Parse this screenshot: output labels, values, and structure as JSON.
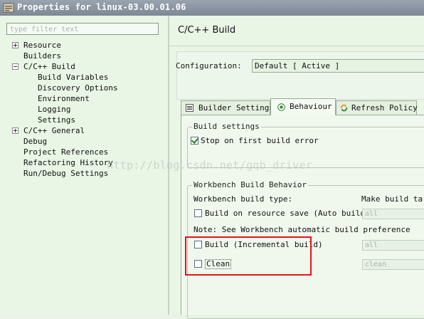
{
  "window": {
    "title": "Properties for linux-03.00.01.06",
    "icon": "properties-icon"
  },
  "sidebar": {
    "filter_placeholder": "type filter text",
    "items": [
      {
        "label": "Resource",
        "toggle": "plus"
      },
      {
        "label": "Builders"
      },
      {
        "label": "C/C++ Build",
        "toggle": "minus"
      },
      {
        "label": "Build Variables"
      },
      {
        "label": "Discovery Options"
      },
      {
        "label": "Environment"
      },
      {
        "label": "Logging"
      },
      {
        "label": "Settings"
      },
      {
        "label": "C/C++ General",
        "toggle": "plus"
      },
      {
        "label": "Debug"
      },
      {
        "label": "Project References"
      },
      {
        "label": "Refactoring History"
      },
      {
        "label": "Run/Debug Settings"
      }
    ]
  },
  "main": {
    "title": "C/C++ Build",
    "configuration_label": "Configuration:",
    "configuration_value": "Default  [ Active ]",
    "tabs": [
      {
        "label": "Builder Settings",
        "icon": "settings-list-icon"
      },
      {
        "label": "Behaviour",
        "icon": "radio-icon",
        "active": true
      },
      {
        "label": "Refresh Policy",
        "icon": "refresh-icon"
      }
    ],
    "build_settings": {
      "legend": "Build settings",
      "stop_on_first_error": {
        "label": "Stop on first build error",
        "checked": true
      }
    },
    "workbench": {
      "legend": "Workbench Build Behavior",
      "build_type_label": "Workbench build type:",
      "make_target_label": "Make build targ",
      "auto_build": {
        "label": "Build on resource save (Auto build)",
        "checked": false,
        "target": "all"
      },
      "note": "Note: See Workbench automatic build preference",
      "incremental": {
        "label": "Build (Incremental build)",
        "checked": false,
        "target": "all"
      },
      "clean": {
        "label": "Clean",
        "checked": false,
        "target": "clean"
      }
    }
  },
  "watermark": "http://blog.csdn.net/gqb_driver",
  "colors": {
    "background": "#e9f5e5",
    "highlight": "#e8121a",
    "titlebar": "#8a949f"
  }
}
